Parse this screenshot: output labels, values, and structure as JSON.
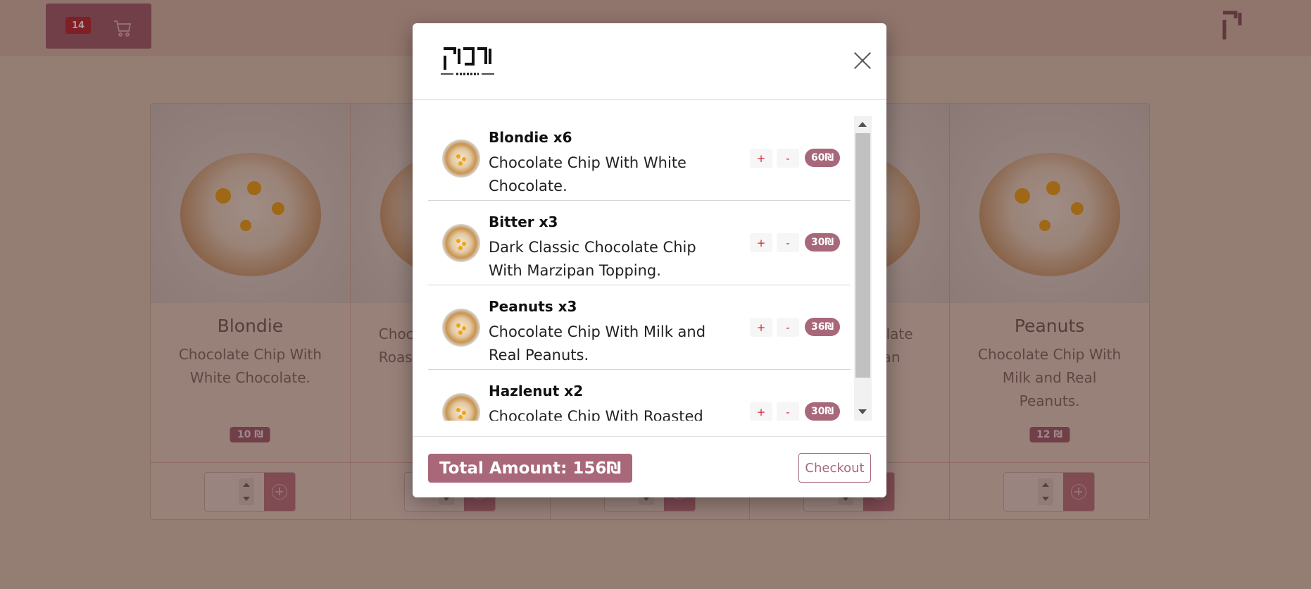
{
  "header": {
    "cart_count": "14",
    "cart_icon": "cart-icon",
    "brand_icon": "brand-logo-icon"
  },
  "products": [
    {
      "title": "Blondie",
      "description": "Chocolate Chip With White Chocolate.",
      "price": "10 ₪"
    },
    {
      "title": "",
      "description": "Choc Roast",
      "price": ""
    },
    {
      "title": "",
      "description": "",
      "price": ""
    },
    {
      "title": "",
      "description": "colate ipan",
      "price": ""
    },
    {
      "title": "Peanuts",
      "description": "Chocolate Chip With Milk and Real Peanuts.",
      "price": "12 ₪"
    }
  ],
  "modal": {
    "logo": "logo",
    "close_icon": "close-icon",
    "items": [
      {
        "title": "Blondie x6",
        "description": "Chocolate Chip With White Chocolate.",
        "plus": "+",
        "minus": "-",
        "price": "60₪"
      },
      {
        "title": "Bitter x3",
        "description": "Dark Classic Chocolate Chip With Marzipan Topping.",
        "plus": "+",
        "minus": "-",
        "price": "30₪"
      },
      {
        "title": "Peanuts x3",
        "description": "Chocolate Chip With Milk and Real Peanuts.",
        "plus": "+",
        "minus": "-",
        "price": "36₪"
      },
      {
        "title": "Hazlenut x2",
        "description": "Chocolate Chip With Roasted",
        "plus": "+",
        "minus": "-",
        "price": "30₪"
      }
    ],
    "total": "Total Amount: 156₪",
    "checkout_label": "Checkout"
  },
  "colors": {
    "accent": "#a8687a",
    "danger": "#d9232f"
  }
}
